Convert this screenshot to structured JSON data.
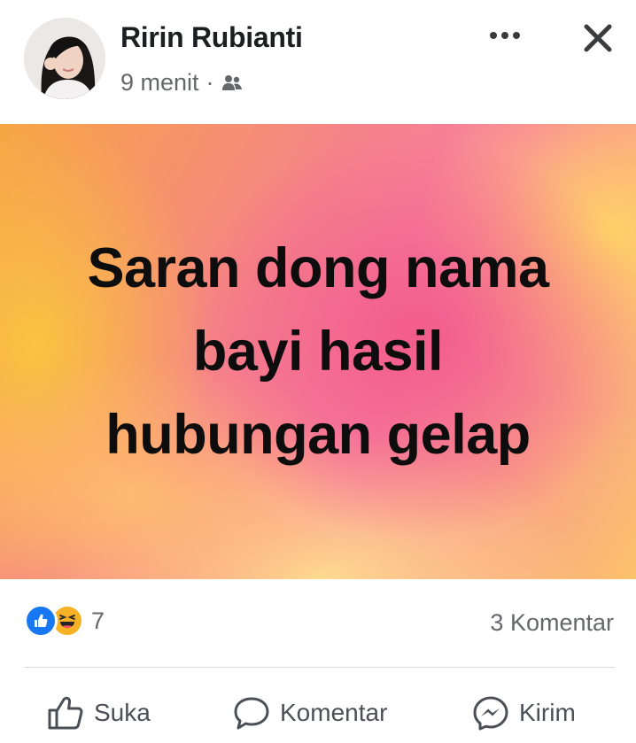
{
  "post": {
    "author": "Ririn Rubianti",
    "time": "9 menit",
    "separator": "·",
    "audience_icon": "friends-icon",
    "text_lines": [
      "Saran dong nama",
      "bayi hasil",
      "hubungan gelap"
    ],
    "background_colors": [
      "#f7a545",
      "#f25a8c",
      "#fbc26c"
    ]
  },
  "header_actions": {
    "more_icon": "more-dots-icon",
    "close_icon": "close-icon"
  },
  "stats": {
    "reactions": [
      "like",
      "haha"
    ],
    "reaction_count": "7",
    "comments": "3 Komentar"
  },
  "actions": {
    "like_label": "Suka",
    "comment_label": "Komentar",
    "send_label": "Kirim"
  },
  "colors": {
    "like_blue": "#1877f2",
    "haha_yellow": "#f7b125",
    "secondary_text": "#65676b"
  }
}
